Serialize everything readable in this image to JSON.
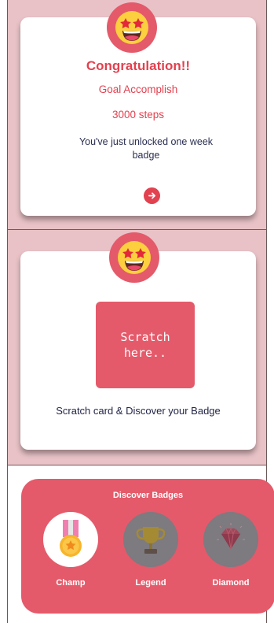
{
  "card1": {
    "title": "Congratulation!!",
    "subtitle": "Goal Accomplish",
    "steps": "3000 steps",
    "message": "You've just unlocked one week badge",
    "emoji_icon": "star-eyes-emoji-icon",
    "next_icon": "arrow-right-icon"
  },
  "card2": {
    "scratch_text": "Scratch\nhere..",
    "caption": "Scratch card & Discover your Badge",
    "emoji_icon": "star-eyes-emoji-icon"
  },
  "badges": {
    "title": "Discover Badges",
    "items": [
      {
        "label": "Champ",
        "icon": "medal-icon",
        "unlocked": true
      },
      {
        "label": "Legend",
        "icon": "trophy-icon",
        "unlocked": false
      },
      {
        "label": "Diamond",
        "icon": "diamond-icon",
        "unlocked": false
      }
    ]
  },
  "colors": {
    "accent": "#e2414f",
    "card_red": "#e45a6a",
    "panel_pink": "#e8c2c6",
    "text_dark": "#2b2f52"
  }
}
